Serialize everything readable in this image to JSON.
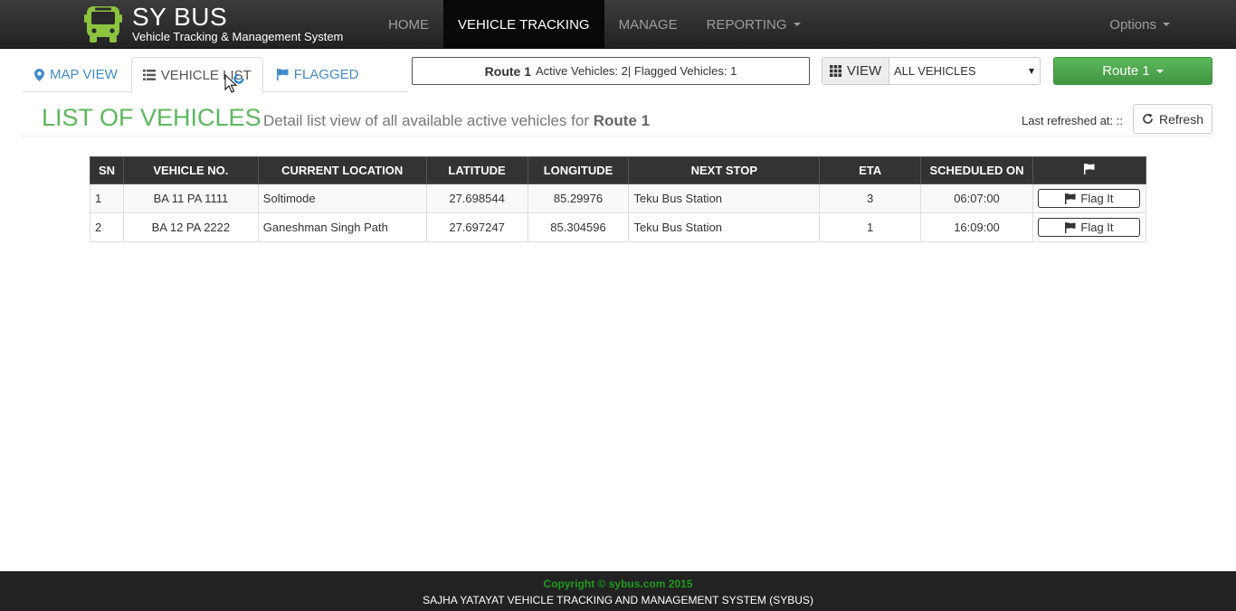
{
  "brand": {
    "title": "SY BUS",
    "subtitle": "Vehicle Tracking & Management System",
    "icon": "bus-icon",
    "icon_color": "#8cc43f"
  },
  "nav": {
    "items": [
      {
        "label": "HOME",
        "active": false
      },
      {
        "label": "VEHICLE TRACKING",
        "active": true
      },
      {
        "label": "MANAGE",
        "active": false
      },
      {
        "label": "REPORTING",
        "active": false,
        "dropdown": true
      }
    ],
    "options_label": "Options"
  },
  "tabs": [
    {
      "label": "MAP VIEW",
      "icon": "map-marker-icon",
      "active": false
    },
    {
      "label": "VEHICLE LIST",
      "icon": "list-icon",
      "active": true
    },
    {
      "label": "FLAGGED",
      "icon": "flag-icon",
      "active": false
    }
  ],
  "route_summary": {
    "route": "Route 1",
    "stats": "Active Vehicles: 2| Flagged Vehicles: 1"
  },
  "view": {
    "label": "VIEW",
    "selected": "ALL VEHICLES"
  },
  "route_button": "Route 1",
  "header": {
    "title": "LIST OF VEHICLES",
    "description": "Detail list view of all available active vehicles for",
    "route": "Route 1",
    "last_refreshed": "Last refreshed at: ::",
    "refresh_label": "Refresh"
  },
  "table": {
    "columns": [
      "SN",
      "VEHICLE NO.",
      "CURRENT LOCATION",
      "LATITUDE",
      "LONGITUDE",
      "NEXT STOP",
      "ETA",
      "SCHEDULED ON"
    ],
    "rows": [
      {
        "sn": "1",
        "vehicle_no": "BA 11 PA 1111",
        "location": "Soltimode",
        "lat": "27.698544",
        "lng": "85.29976",
        "next_stop": "Teku Bus Station",
        "eta": "3",
        "scheduled": "06:07:00",
        "flag": "Flag It"
      },
      {
        "sn": "2",
        "vehicle_no": "BA 12 PA 2222",
        "location": "Ganeshman Singh Path",
        "lat": "27.697247",
        "lng": "85.304596",
        "next_stop": "Teku Bus Station",
        "eta": "1",
        "scheduled": "16:09:00",
        "flag": "Flag It"
      }
    ]
  },
  "footer": {
    "copyright": "Copyright © sybus.com 2015",
    "system": "SAJHA YATAYAT VEHICLE TRACKING AND MANAGEMENT SYSTEM (SYBUS)"
  },
  "colors": {
    "accent_green": "#5cb85c",
    "navbar_dark": "#222222",
    "link_blue": "#428bca"
  }
}
